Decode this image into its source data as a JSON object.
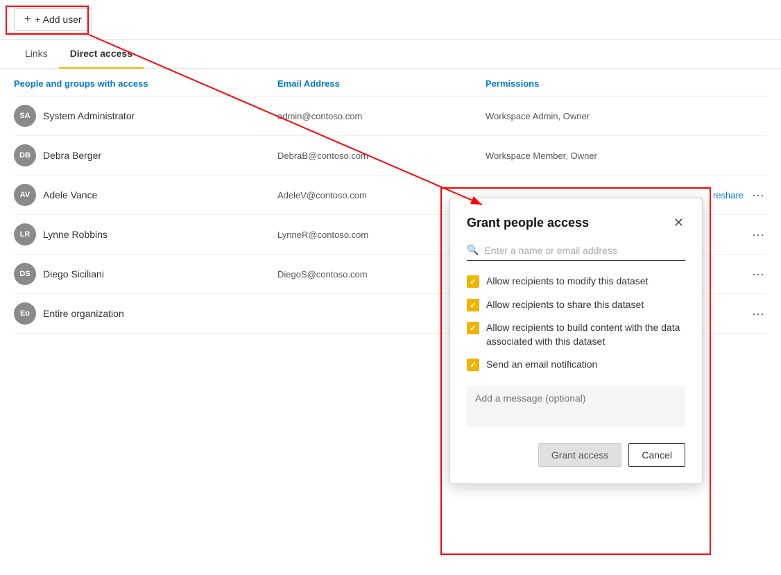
{
  "toolbar": {
    "add_user_label": "+ Add user"
  },
  "tabs": {
    "links": "Links",
    "direct_access": "Direct access"
  },
  "table": {
    "headers": {
      "people": "People and groups with access",
      "email": "Email Address",
      "permissions": "Permissions"
    },
    "rows": [
      {
        "initials": "SA",
        "name": "System Administrator",
        "email": "admin@contoso.com",
        "permissions": "Workspace Admin, Owner",
        "reshare": "",
        "more": "···"
      },
      {
        "initials": "DB",
        "name": "Debra Berger",
        "email": "DebraB@contoso.com",
        "permissions": "Workspace Member, Owner",
        "reshare": "",
        "more": "···"
      },
      {
        "initials": "AV",
        "name": "Adele Vance",
        "email": "AdeleV@contoso.com",
        "permissions": "",
        "reshare": "reshare",
        "more": "···"
      },
      {
        "initials": "LR",
        "name": "Lynne Robbins",
        "email": "LynneR@contoso.com",
        "permissions": "",
        "reshare": "",
        "more": "···"
      },
      {
        "initials": "DS",
        "name": "Diego Siciliani",
        "email": "DiegoS@contoso.com",
        "permissions": "",
        "reshare": "",
        "more": "···"
      },
      {
        "initials": "Eo",
        "name": "Entire organization",
        "email": "",
        "permissions": "",
        "reshare": "",
        "more": "···"
      }
    ]
  },
  "dialog": {
    "title": "Grant people access",
    "search_placeholder": "Enter a name or email address",
    "checkboxes": [
      {
        "label": "Allow recipients to modify this dataset",
        "checked": true
      },
      {
        "label": "Allow recipients to share this dataset",
        "checked": true
      },
      {
        "label": "Allow recipients to build content with the data associated with this dataset",
        "checked": true
      },
      {
        "label": "Send an email notification",
        "checked": true
      }
    ],
    "message_placeholder": "Add a message (optional)",
    "grant_button": "Grant access",
    "cancel_button": "Cancel"
  }
}
